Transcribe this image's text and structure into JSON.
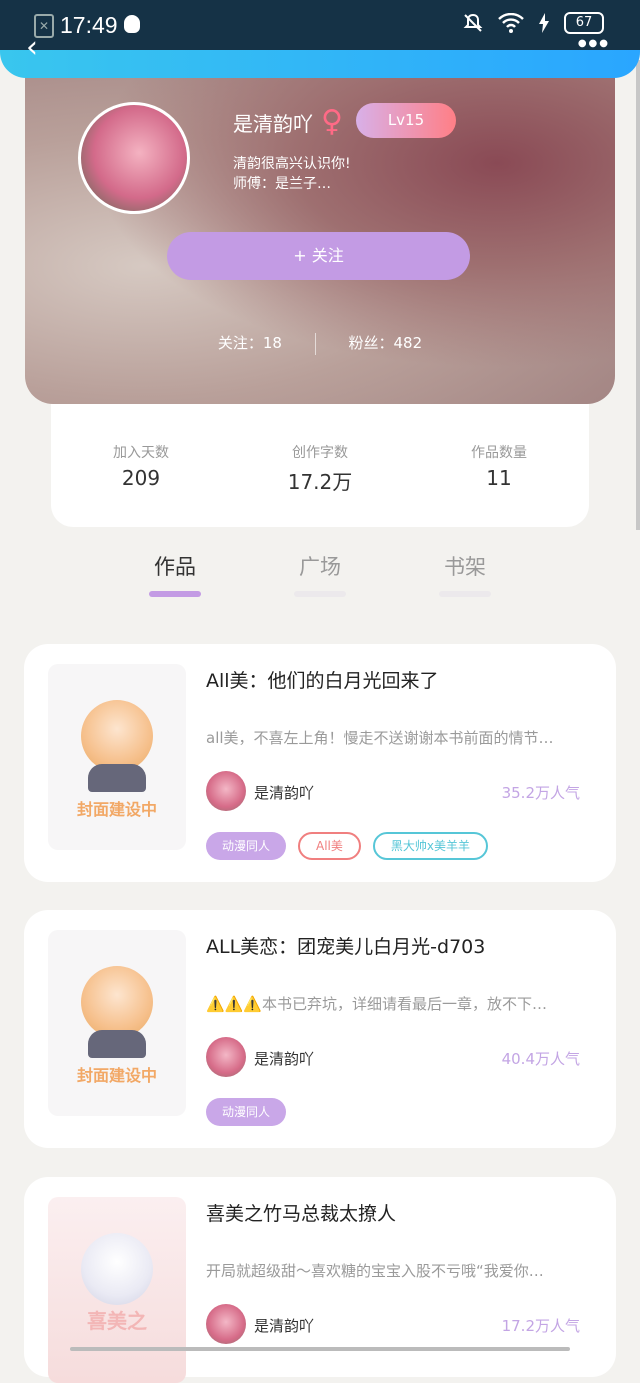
{
  "status_bar": {
    "time": "17:49",
    "battery": "67"
  },
  "profile": {
    "username": "是清韵吖",
    "gender_symbol": "♀",
    "level": "Lv15",
    "bio_line1": "清韵很高兴认识你!",
    "bio_line2": "师傅：是兰子…",
    "follow_label": "+  关注",
    "following": "关注：18",
    "fans": "粉丝：482"
  },
  "stats": [
    {
      "label": "加入天数",
      "value": "209"
    },
    {
      "label": "创作字数",
      "value": "17.2万"
    },
    {
      "label": "作品数量",
      "value": "11"
    }
  ],
  "tabs": [
    {
      "label": "作品",
      "active": true
    },
    {
      "label": "广场",
      "active": false
    },
    {
      "label": "书架",
      "active": false
    }
  ],
  "works": [
    {
      "title": "All美：他们的白月光回来了",
      "desc": "all美，不喜左上角！慢走不送谢谢本书前面的情节…",
      "author": "是清韵吖",
      "popularity": "35.2万人气",
      "cover_text": "封面建设中",
      "tags": [
        "动漫同人",
        "All美",
        "黑大帅x美羊羊"
      ]
    },
    {
      "title": "ALL美恋：团宠美儿白月光-d703",
      "desc": "⚠️⚠️⚠️本书已弃坑，详细请看最后一章，放不下…",
      "author": "是清韵吖",
      "popularity": "40.4万人气",
      "cover_text": "封面建设中",
      "tags": [
        "动漫同人"
      ]
    },
    {
      "title": "喜美之竹马总裁太撩人",
      "desc": "开局就超级甜～喜欢糖的宝宝入股不亏哦“我爱你…",
      "author": "是清韵吖",
      "popularity": "17.2万人气",
      "cover_text": "喜美之"
    }
  ],
  "colors": {
    "accent": "#c39be4",
    "status_bar": "#153246",
    "top_bar": "#2aa6ff"
  }
}
